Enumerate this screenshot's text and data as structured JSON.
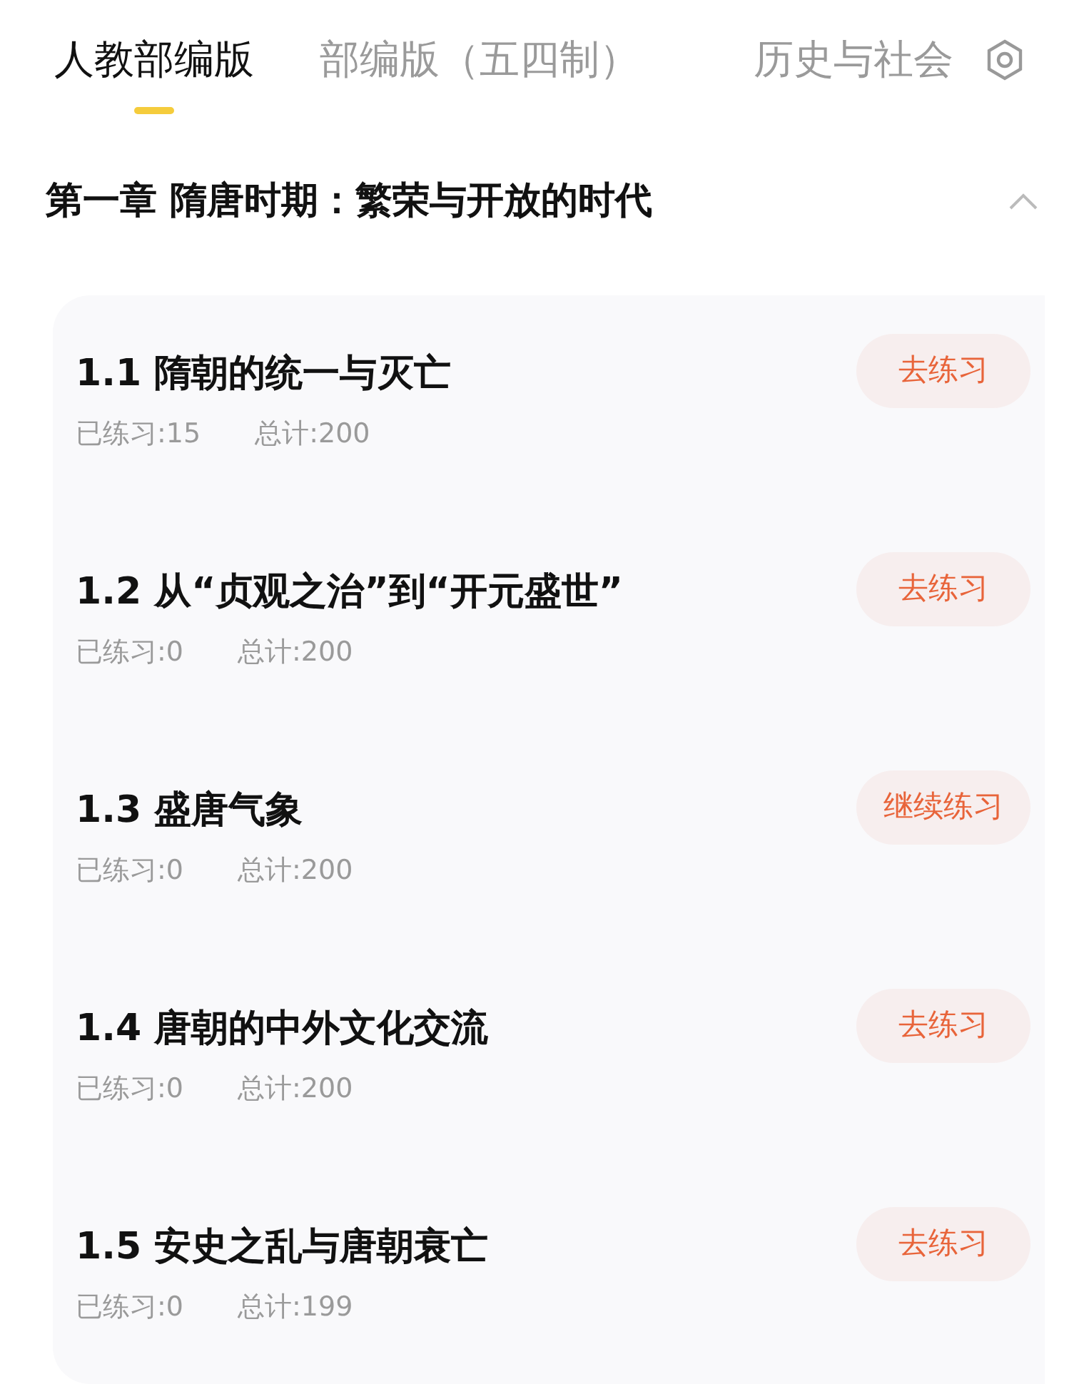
{
  "tabs": [
    {
      "label": "人教部编版",
      "selected": true
    },
    {
      "label": "部编版（五四制）",
      "selected": false
    },
    {
      "label": "历史与社会",
      "selected": false
    }
  ],
  "chapter": {
    "title": "第一章 隋唐时期：繁荣与开放的时代",
    "expanded": true
  },
  "lessons": [
    {
      "title": "1.1 隋朝的统一与灭亡",
      "practiced": "已练习:15",
      "total": "总计:200",
      "button": "去练习"
    },
    {
      "title": "1.2 从“贞观之治”到“开元盛世”",
      "practiced": "已练习:0",
      "total": "总计:200",
      "button": "去练习"
    },
    {
      "title": "1.3 盛唐气象",
      "practiced": "已练习:0",
      "total": "总计:200",
      "button": "继续练习"
    },
    {
      "title": "1.4 唐朝的中外文化交流",
      "practiced": "已练习:0",
      "total": "总计:200",
      "button": "去练习"
    },
    {
      "title": "1.5 安史之乱与唐朝衰亡",
      "practiced": "已练习:0",
      "total": "总计:199",
      "button": "去练习"
    }
  ]
}
